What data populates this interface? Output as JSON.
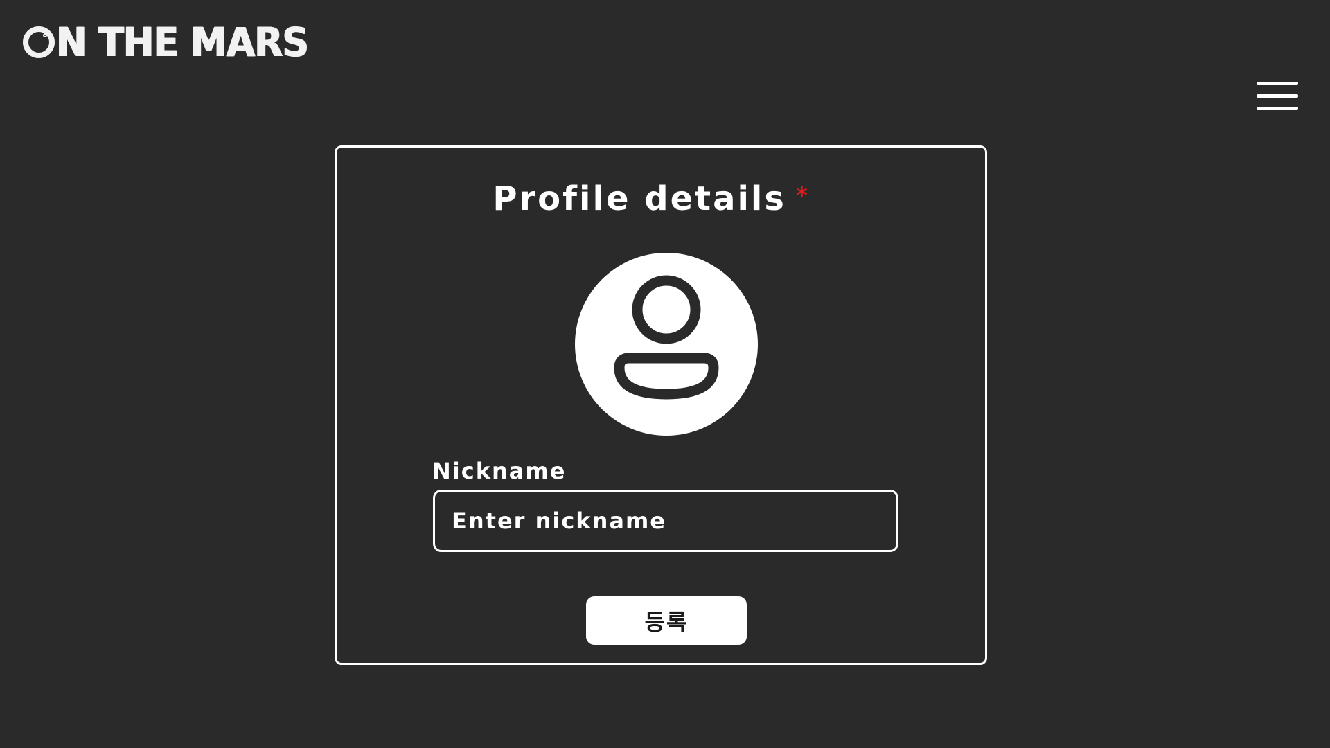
{
  "header": {
    "logo_text": "ON THE MARS",
    "logo_display": "N THE MARS",
    "menu_icon": "hamburger-menu-icon"
  },
  "profile_form": {
    "title": "Profile details",
    "required_mark": "*",
    "avatar_icon": "user-avatar-icon",
    "nickname_label": "Nickname",
    "nickname_placeholder": "Enter nickname",
    "nickname_value": "",
    "submit_label": "등록"
  },
  "colors": {
    "background": "#2a2a2a",
    "foreground": "#ffffff",
    "required": "#e31b1b"
  }
}
